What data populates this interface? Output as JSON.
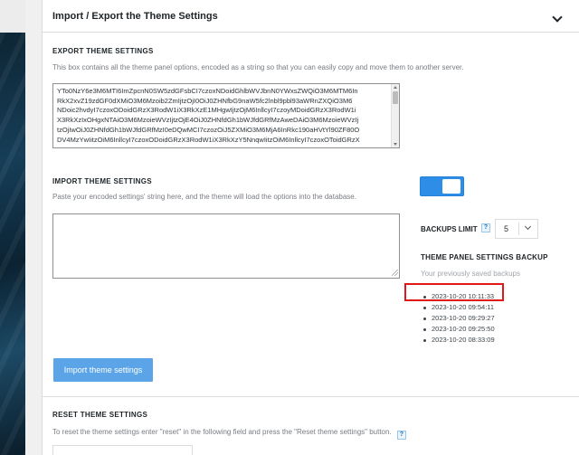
{
  "panel": {
    "title": "Import / Export the Theme Settings"
  },
  "export": {
    "title": "EXPORT THEME SETTINGS",
    "description": "This box contains all the theme panel options, encoded as a string so that you can easily copy and move them to another server.",
    "lines": [
      "YTo0NzY6e3M6MTI6ImZpcnN0SW5zdGFsbCI7czoxNDoidGhlbWVJbnN0YWxsZWQiO3M6MTM6In",
      "RkX2xvZ19zdGF0dXMiO3M6Mzoib2ZmIjtzOjI0OiJ0ZHNfbG9naW5fc2lnbl9pbl93aWRnZXQiO3M6",
      "NDoic2hvdyI7czoxODoidGRzX3RodW1iX3RkXzE1MHgwIjtzOjM6InllcyI7czoyMDoidGRzX3RodW1i",
      "X3RkXzIxOHgxNTAiO3M6MzoieWVzIjtzOjE4OiJ0ZHNfdGh1bWJfdGRfMzAweDAiO3M6MzoieWVzIj",
      "tzOjIwOiJ0ZHNfdGh1bWJfdGRfMzI0eDQwMCI7czozOiJ5ZXMiO3M6MjA6InRkc190aHVtYl90ZF80O",
      "DV4MzYwIitzOiM6InllcyI7czoxODoidGRzX3RodW1iX3RkXzY5NnqwIitzOiM6InllcyI7czoxOToidGRzX"
    ]
  },
  "import": {
    "title": "IMPORT THEME SETTINGS",
    "description": "Paste your encoded settings' string here, and the theme will load the options into the database.",
    "textarea_value": "",
    "button_label": "Import theme settings"
  },
  "backups": {
    "toggle_on": true,
    "limit_label": "BACKUPS LIMIT",
    "help": "?",
    "limit_value": "5",
    "panel_title": "THEME PANEL SETTINGS BACKUP",
    "subtitle": "Your previously saved backups",
    "items": [
      "2023-10-20 10:11:33",
      "2023-10-20 09:54:11",
      "2023-10-20 09:29:27",
      "2023-10-20 09:25:50",
      "2023-10-20 08:33:09"
    ],
    "highlight_color": "#e01818"
  },
  "reset": {
    "title": "RESET THEME SETTINGS",
    "description": "To reset the theme settings enter \"reset\" in the following field and press the \"Reset theme settings\" button.",
    "help": "?",
    "input_value": ""
  },
  "colors": {
    "accent": "#2e8de6",
    "button": "#5ba4e8"
  }
}
